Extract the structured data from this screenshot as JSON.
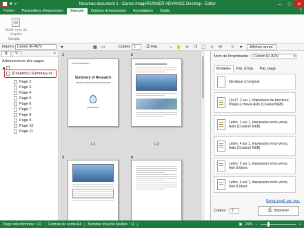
{
  "window": {
    "title": "Nouveau document 1 - Canon imageRUNNER ADVANCE Desktop - Editor",
    "min": "–",
    "max": "□",
    "close": "✕"
  },
  "ribbon": {
    "tabs": [
      "Fichier",
      "Paramètres d'impression",
      "Sample",
      "Options d'impression",
      "Annotations",
      "Outils"
    ],
    "active_tab": "Sample",
    "button_label": "Modif. nom du chapitre",
    "group_label": "Sample"
  },
  "toolbar": {
    "printer_label": "Imprim",
    "printer_value": "Canon iR-ADV",
    "copies_label": "Copies",
    "copies_value": "1",
    "imp_label": "Imp.",
    "show_annot_label": "Afficher annot."
  },
  "left_panel": {
    "tab1": "⎘",
    "tab2": "✎",
    "close": "×",
    "heading": "Arborescence des pages",
    "chapter": "[Chapitre1] Summary of",
    "pages": [
      "Page 2",
      "Page 3",
      "Page 4",
      "Page 5",
      "Page 6",
      "Page 7",
      "Page 8",
      "Page 9",
      "Page 10",
      "Page 11"
    ]
  },
  "pages": {
    "p1_num": "1",
    "p2_num": "2",
    "p3_num": "3",
    "p4_num": "4",
    "label_1": "1-1",
    "label_2": "1-2",
    "p1_head": "XX-XX Corporation",
    "p1_title": "Summary of Research",
    "p1_sub": "XXXXXXXXXXXXXXXXXXXXXXXXXXX",
    "p1_date": "XX MAY 20XX",
    "p2_title": "XXXXXXXXXXXXXXXXXXXXXXX"
  },
  "right_panel": {
    "printer_label": "Nom de l'imprimante :",
    "printer_value": "Canon iR-ADV",
    "tabs": [
      "Modèles",
      "Par. d'imp.",
      "Par. page"
    ],
    "models": [
      "Identique à l'original",
      "11x17, 2 sur 1, Impression de brochure, Pliage à cheval Auto (Couleur/N&B)",
      "Lettre, 2 sur 1, Impression recto-verso, Auto (Couleur/ N&B)",
      "Lettre, 4 sur 1, Impression recto-verso, Auto (Couleur/ N&B)",
      "Lettre, 2 sur 1, Impression recto-verso, Noir & blanc",
      "Lettre, 4 sur 1, Impression recto-verso, Noir & blanc"
    ],
    "link": "Enreg./modi. par. imp.",
    "copies_label": "Copies :",
    "copies_value": "1",
    "print_button": "Imprimer"
  },
  "status": {
    "selected": "Page sélectionnée : /11",
    "format": "Format de sortie:A4",
    "sheets": "Nombre total de feuilles : 11",
    "zoom": "29%"
  }
}
